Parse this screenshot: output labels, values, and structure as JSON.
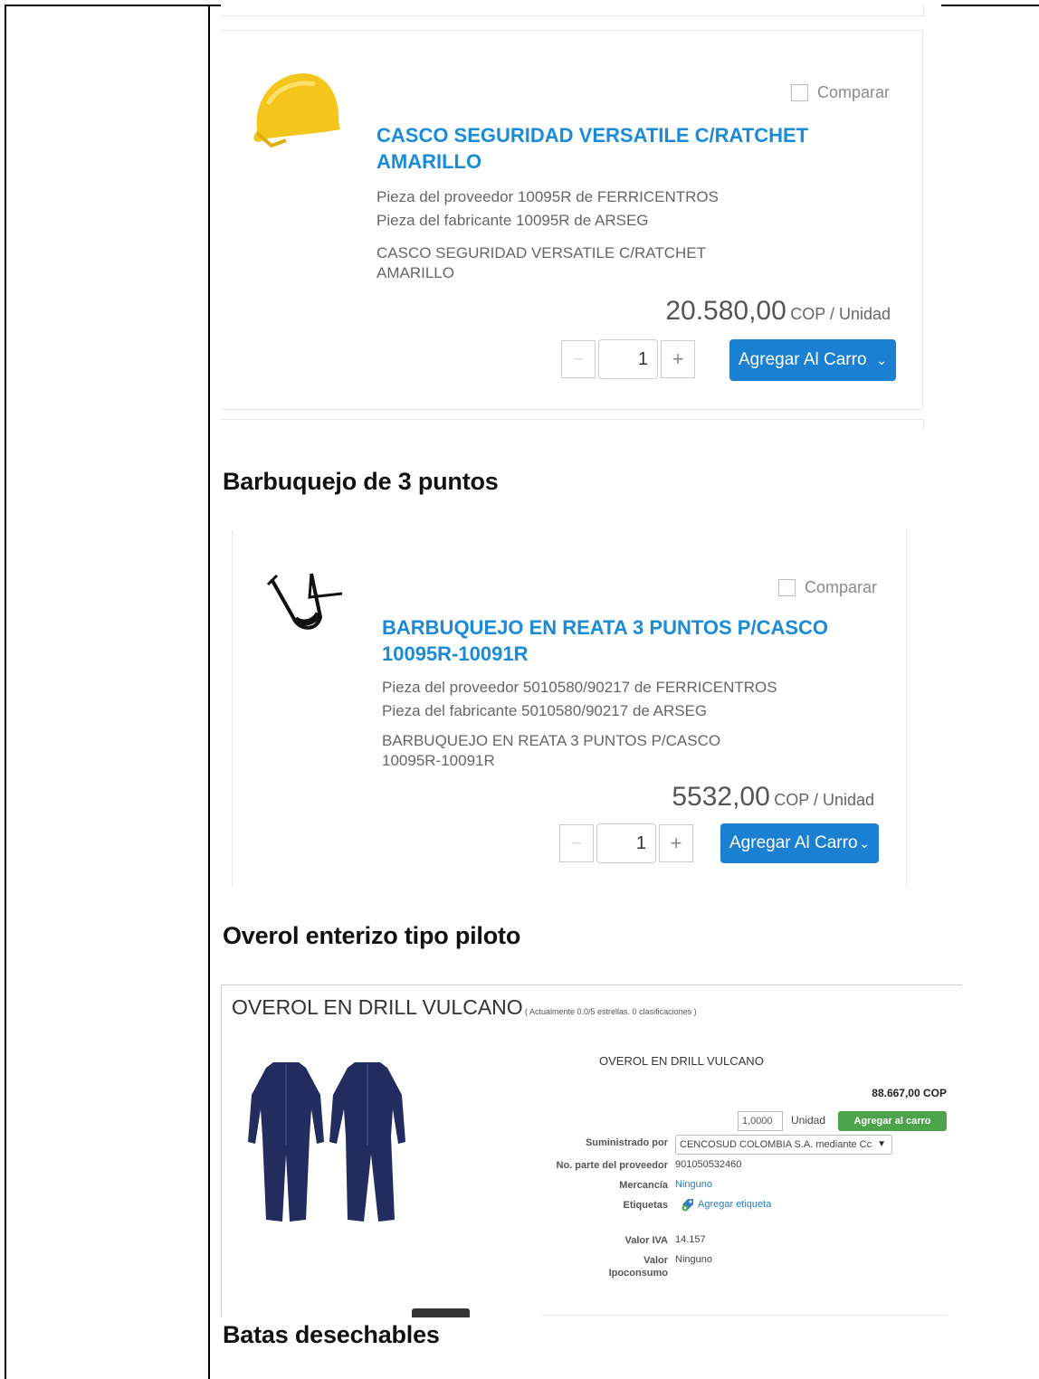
{
  "headings": {
    "chinstrap": "Barbuquejo de 3 puntos",
    "coverall": "Overol enterizo tipo piloto",
    "gowns": "Batas desechables"
  },
  "helmet_card": {
    "compare": "Comparar",
    "title_line1": "CASCO SEGURIDAD VERSATILE C/RATCHET",
    "title_line2": "AMARILLO",
    "supplier_part": "Pieza del proveedor 10095R de FERRICENTROS",
    "manufacturer_part": "Pieza del fabricante 10095R de ARSEG",
    "desc_line1": "CASCO SEGURIDAD VERSATILE C/RATCHET",
    "desc_line2": "AMARILLO",
    "price": "20.580,00",
    "unit": "COP / Unidad",
    "minus": "−",
    "plus": "+",
    "qty": "1",
    "add_label": "Agregar Al Carro",
    "chevron": "⌄"
  },
  "chinstrap_card": {
    "compare": "Comparar",
    "title_line1": "BARBUQUEJO EN REATA 3 PUNTOS P/CASCO",
    "title_line2": "10095R-10091R",
    "supplier_part": "Pieza del proveedor 5010580/90217 de FERRICENTROS",
    "manufacturer_part": "Pieza del fabricante 5010580/90217 de ARSEG",
    "desc_line1": "BARBUQUEJO EN REATA 3 PUNTOS P/CASCO",
    "desc_line2": "10095R-10091R",
    "price": "5532,00",
    "unit": "COP / Unidad",
    "minus": "−",
    "plus": "+",
    "qty": "1",
    "add_label": "Agregar Al Carro",
    "chevron": "⌄"
  },
  "coverall": {
    "title": "OVEROL EN DRILL VULCANO",
    "rating": "( Actualmente 0.0/5 estrellas. 0 clasificaciones )",
    "description": "OVEROL EN DRILL VULCANO",
    "price": "88.667,00 COP",
    "qty": "1,0000",
    "unit": "Unidad",
    "add_label": "Agregar al carro",
    "supplied_by_label": "Suministrado por",
    "supplied_by_value": "CENCOSUD COLOMBIA S.A. mediante Cc",
    "part_label": "No. parte del proveedor",
    "part_value": "901050532460",
    "goods_label": "Mercancía",
    "goods_value": "Ninguno",
    "tags_label": "Etiquetas",
    "tags_value": "Agregar etiqueta",
    "iva_label": "Valor IVA",
    "iva_value": "14.157",
    "ipo_label_line1": "Valor",
    "ipo_label_line2": "Ipoconsumo",
    "ipo_value": "Ninguno"
  }
}
